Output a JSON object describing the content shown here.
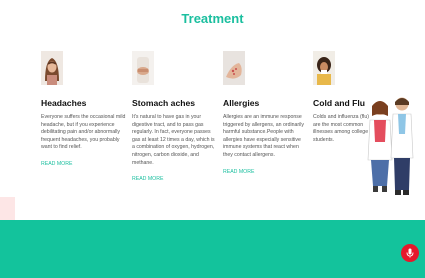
{
  "section": {
    "title": "Treatment"
  },
  "cards": [
    {
      "title": "Headaches",
      "text": "Everyone suffers the occasional mild headache, but if you experience debilitating pain and/or abnormally frequent headaches, you probably want to find relief.",
      "link": "READ MORE",
      "image": "headache-woman-photo"
    },
    {
      "title": "Stomach aches",
      "text": "It's natural to have gas in your digestive tract, and to pass gas regularly. In fact, everyone passes gas at least 12 times a day, which is a combination of oxygen, hydrogen, nitrogen, carbon dioxide, and methane.",
      "link": "READ MORE",
      "image": "stomach-ache-photo"
    },
    {
      "title": "Allergies",
      "text": "Allergies are an immune response triggered by allergens, an ordinarily harmful substance.People with allergies have especially sensitive immune systems that react when they contact allergens.",
      "link": "READ MORE",
      "image": "allergy-hand-photo"
    },
    {
      "title": "Cold and Flu",
      "text": "Colds and influenza (flu) are the most common illnesses among college students.",
      "link": "",
      "image": "cold-flu-woman-photo"
    }
  ],
  "colors": {
    "accent": "#1bbf9f",
    "footer": "#13c39c",
    "mic": "#e7172a"
  },
  "icons": {
    "mic": "microphone-icon"
  }
}
